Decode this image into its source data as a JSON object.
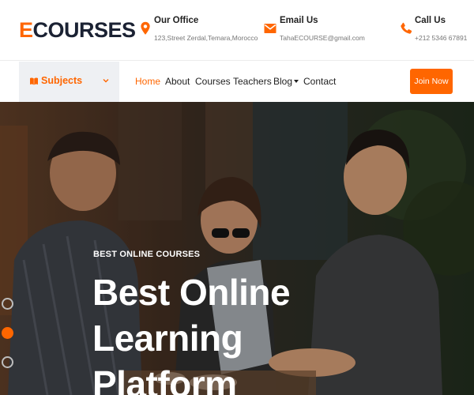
{
  "brand": {
    "logo_first": "E",
    "logo_rest": "COURSES",
    "accent": "#ff6600",
    "dark": "#1b2233"
  },
  "contact": {
    "office": {
      "title": "Our Office",
      "value": "123,Street Zerdal,Temara,Morocco",
      "icon": "map-pin-icon"
    },
    "email": {
      "title": "Email Us",
      "value": "TahaECOURSE@gmail.com",
      "icon": "envelope-icon"
    },
    "phone": {
      "title": "Call Us",
      "value": "+212 5346 67891",
      "icon": "phone-icon"
    }
  },
  "nav": {
    "subjects_label": "Subjects",
    "links": [
      {
        "label": "Home",
        "active": true
      },
      {
        "label": "About"
      },
      {
        "label": "Courses"
      },
      {
        "label": "Teachers"
      },
      {
        "label": "Blog",
        "dropdown": true
      },
      {
        "label": "Contact"
      }
    ],
    "join_label": "Join Now"
  },
  "hero": {
    "kicker": "BEST ONLINE COURSES",
    "headline_line1": "Best Online Learning",
    "headline_line2": "Platform",
    "slides": 3,
    "active_slide": 2
  }
}
